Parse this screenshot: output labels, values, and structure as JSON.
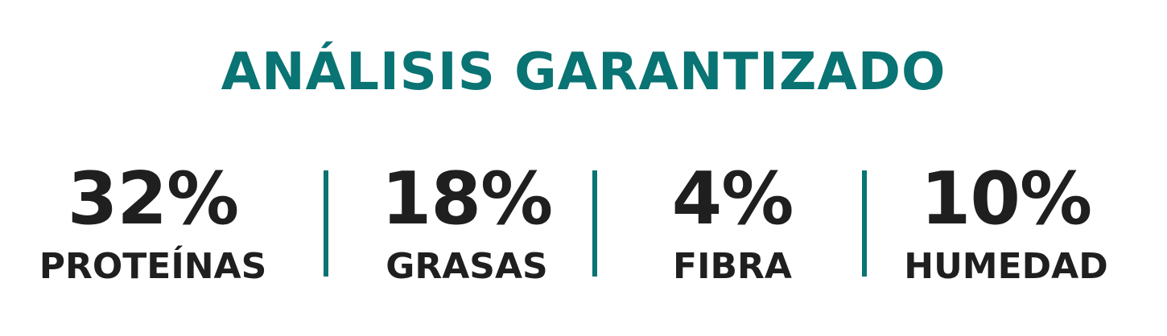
{
  "title": "ANÁLISIS GARANTIZADO",
  "colors": {
    "accent": "#0a7373",
    "text": "#1f1f1f",
    "background": "#ffffff"
  },
  "stats": [
    {
      "value": "32%",
      "label": "PROTEÍNAS"
    },
    {
      "value": "18%",
      "label": "GRASAS"
    },
    {
      "value": "4%",
      "label": "FIBRA"
    },
    {
      "value": "10%",
      "label": "HUMEDAD"
    }
  ]
}
